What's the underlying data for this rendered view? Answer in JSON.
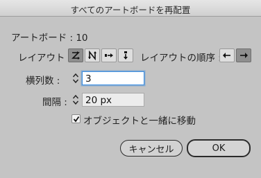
{
  "window": {
    "title": "すべてのアートボードを再配置"
  },
  "artboards": {
    "label": "アートボード : 10"
  },
  "layout": {
    "label": "レイアウト :",
    "options": [
      {
        "name": "grid-by-row",
        "selected": true
      },
      {
        "name": "grid-by-column",
        "selected": false
      },
      {
        "name": "arrange-by-row",
        "selected": false
      },
      {
        "name": "arrange-by-column",
        "selected": false
      }
    ]
  },
  "layout_order": {
    "label": "レイアウトの順序 :",
    "options": [
      {
        "name": "left-to-right",
        "selected": false
      },
      {
        "name": "right-to-left",
        "selected": true
      }
    ]
  },
  "columns": {
    "label": "横列数 :",
    "value": "3"
  },
  "spacing": {
    "label": "間隔 :",
    "value": "20 px"
  },
  "move_artwork": {
    "label": "オブジェクトと一緒に移動",
    "checked": true
  },
  "buttons": {
    "cancel": "キャンセル",
    "ok": "OK"
  },
  "colors": {
    "focus_ring": "#3d8ee0",
    "background": "#c4c4c4"
  }
}
